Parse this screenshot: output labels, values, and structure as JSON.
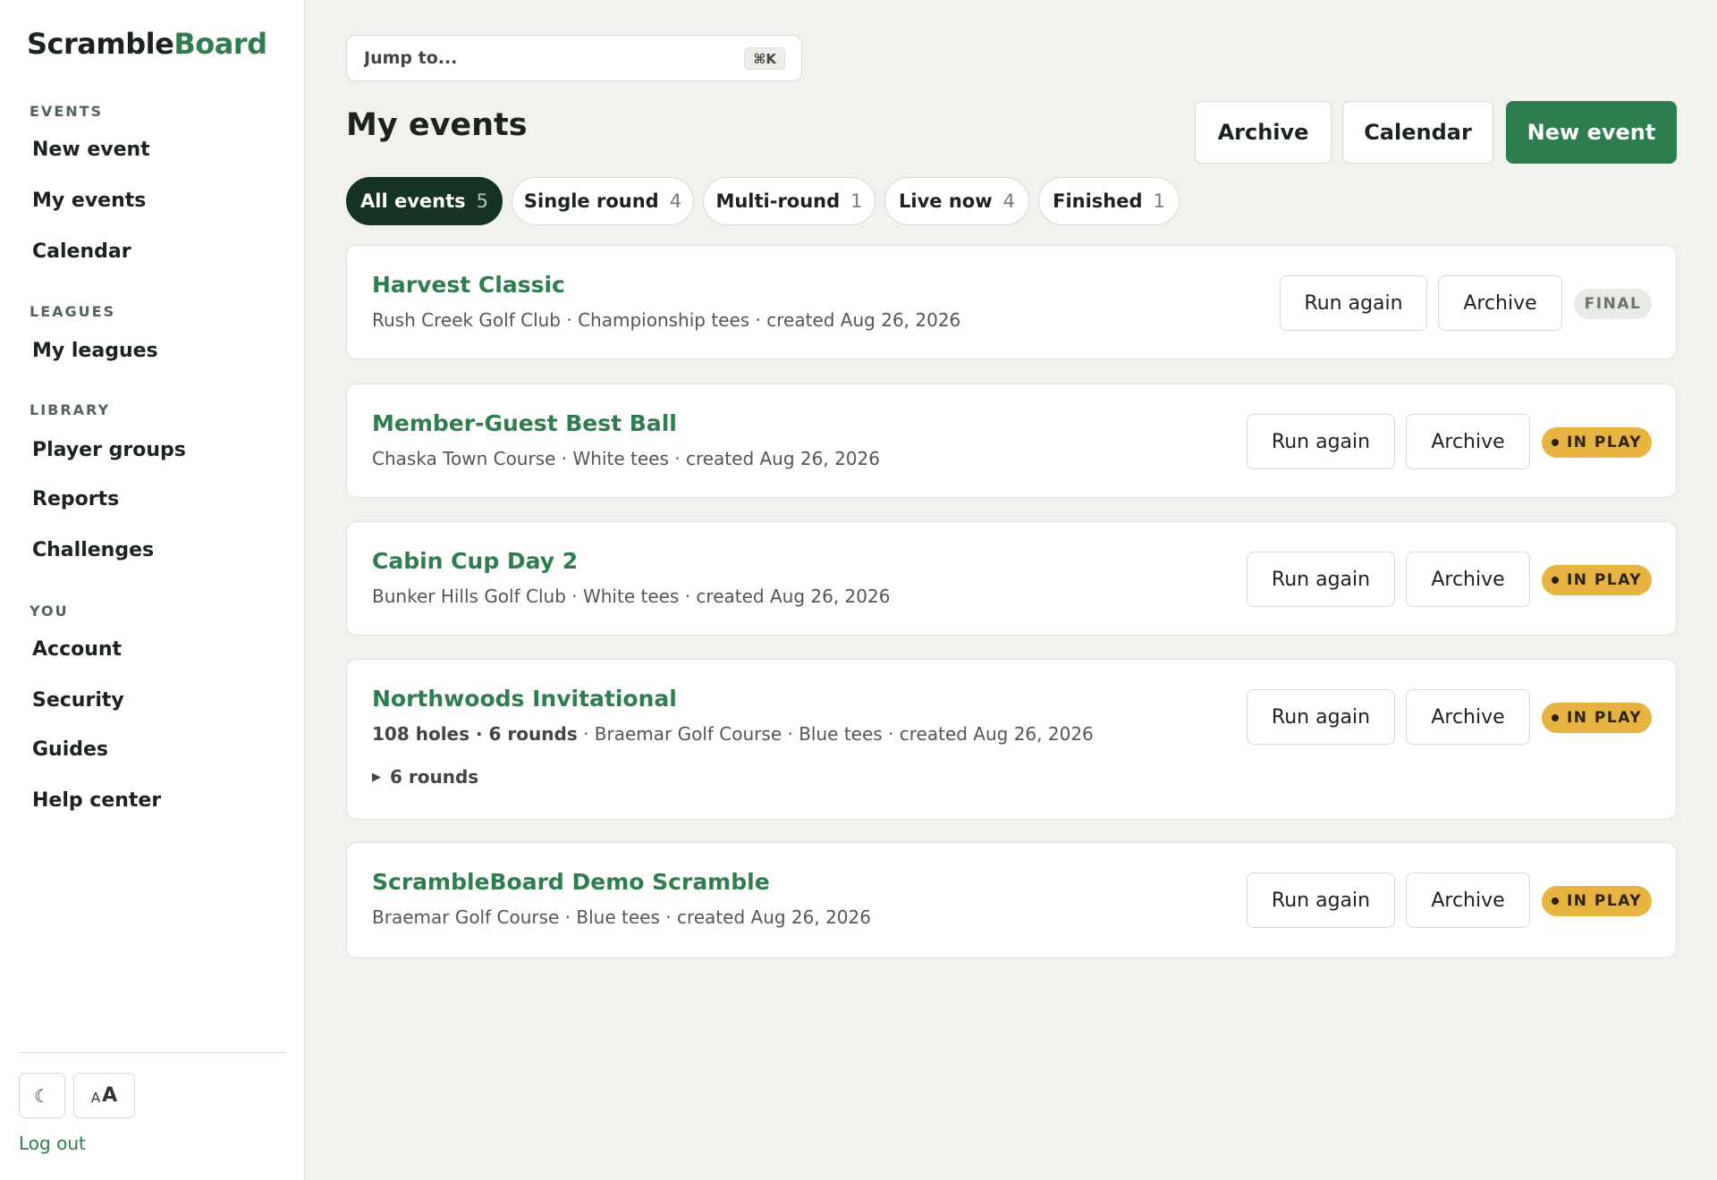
{
  "app": {
    "logo_primary": "Scramble",
    "logo_accent": "Board",
    "accent_color": "#2e7d4f"
  },
  "sidebar": {
    "sections": [
      {
        "title": "EVENTS",
        "items": [
          "New event",
          "My events",
          "Calendar"
        ]
      },
      {
        "title": "LEAGUES",
        "items": [
          "My leagues"
        ]
      },
      {
        "title": "LIBRARY",
        "items": [
          "Player groups",
          "Reports",
          "Challenges"
        ]
      },
      {
        "title": "YOU",
        "items": [
          "Account",
          "Security",
          "Guides",
          "Help center"
        ]
      }
    ],
    "theme_icon": "☾",
    "font_icon_small": "A",
    "font_icon_big": "A",
    "logout": "Log out"
  },
  "search": {
    "placeholder": "Jump to...",
    "shortcut": "⌘K"
  },
  "header": {
    "title": "My events",
    "archive_label": "Archive",
    "calendar_label": "Calendar",
    "new_event_label": "New event"
  },
  "filters": [
    {
      "label": "All events",
      "count": "5",
      "active": true
    },
    {
      "label": "Single round",
      "count": "4",
      "active": false
    },
    {
      "label": "Multi-round",
      "count": "1",
      "active": false
    },
    {
      "label": "Live now",
      "count": "4",
      "active": false
    },
    {
      "label": "Finished",
      "count": "1",
      "active": false
    }
  ],
  "events": [
    {
      "title": "Harvest Classic",
      "meta": "Rush Creek Golf Club · Championship tees · created Aug 26, 2026",
      "run_again": "Run again",
      "archive": "Archive",
      "status": "FINAL",
      "status_type": "final"
    },
    {
      "title": "Member-Guest Best Ball",
      "meta": "Chaska Town Course · White tees · created Aug 26, 2026",
      "run_again": "Run again",
      "archive": "Archive",
      "status": "IN PLAY",
      "status_type": "play"
    },
    {
      "title": "Cabin Cup Day 2",
      "meta": "Bunker Hills Golf Club · White tees · created Aug 26, 2026",
      "run_again": "Run again",
      "archive": "Archive",
      "status": "IN PLAY",
      "status_type": "play"
    },
    {
      "title": "Northwoods Invitational",
      "meta_bold": "108 holes · 6 rounds",
      "meta": " · Braemar Golf Course · Blue tees · created Aug 26, 2026",
      "rounds_toggle": "6 rounds",
      "run_again": "Run again",
      "archive": "Archive",
      "status": "IN PLAY",
      "status_type": "play"
    },
    {
      "title": "ScrambleBoard Demo Scramble",
      "meta": "Braemar Golf Course · Blue tees · created Aug 26, 2026",
      "run_again": "Run again",
      "archive": "Archive",
      "status": "IN PLAY",
      "status_type": "play"
    }
  ]
}
